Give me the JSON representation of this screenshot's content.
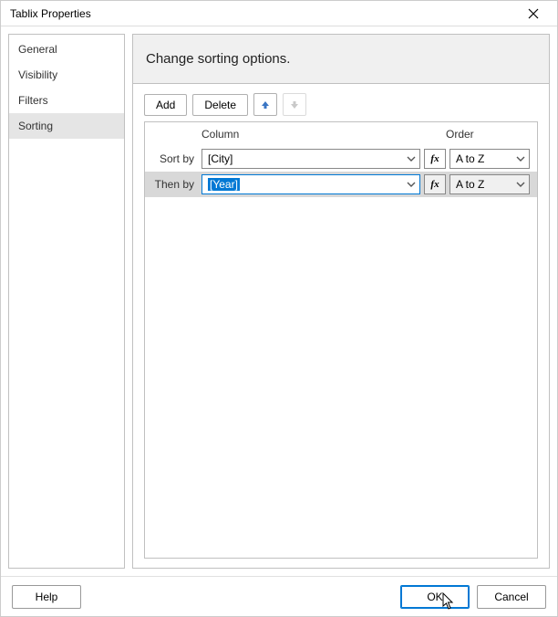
{
  "window": {
    "title": "Tablix Properties"
  },
  "sidebar": {
    "items": [
      {
        "label": "General"
      },
      {
        "label": "Visibility"
      },
      {
        "label": "Filters"
      },
      {
        "label": "Sorting"
      }
    ],
    "selected_index": 3
  },
  "main": {
    "heading": "Change sorting options.",
    "toolbar": {
      "add_label": "Add",
      "delete_label": "Delete"
    },
    "columns": {
      "column_header": "Column",
      "order_header": "Order"
    },
    "rows": [
      {
        "label": "Sort by",
        "column_value": "[City]",
        "order_value": "A to Z",
        "selected": false,
        "focused": false
      },
      {
        "label": "Then by",
        "column_value": "[Year]",
        "order_value": "A to Z",
        "selected": true,
        "focused": true
      }
    ],
    "fx_label": "fx"
  },
  "footer": {
    "help_label": "Help",
    "ok_label": "OK",
    "cancel_label": "Cancel"
  }
}
